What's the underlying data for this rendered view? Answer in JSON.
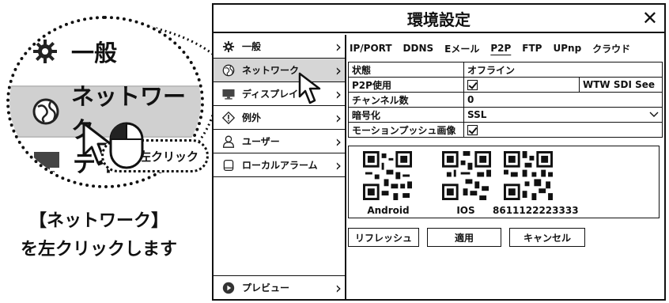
{
  "illustration": {
    "items": [
      {
        "label": "一般",
        "icon": "gear-icon"
      },
      {
        "label": "ネットワーク",
        "icon": "globe-icon"
      },
      {
        "label": "テイ",
        "icon": "monitor-icon"
      }
    ],
    "click_label": "左クリック",
    "instruction_line1": "【ネットワーク】",
    "instruction_line2": "を左クリックします"
  },
  "dialog": {
    "title": "環境設定",
    "close_glyph": "✕",
    "sidebar": [
      {
        "label": "一般",
        "icon": "gear-icon"
      },
      {
        "label": "ネットワーク",
        "icon": "globe-icon",
        "active": true
      },
      {
        "label": "ディスプレイ",
        "icon": "monitor-icon"
      },
      {
        "label": "例外",
        "icon": "warning-icon"
      },
      {
        "label": "ユーザー",
        "icon": "user-icon"
      },
      {
        "label": "ローカルアラーム",
        "icon": "storage-icon"
      }
    ],
    "sidebar_bottom": {
      "label": "プレビュー",
      "icon": "play-icon"
    },
    "chevron": "›",
    "tabs": [
      "IP/PORT",
      "DDNS",
      "Eメール",
      "P2P",
      "FTP",
      "UPnp",
      "クラウド"
    ],
    "active_tab": "P2P",
    "rows": {
      "status_label": "状態",
      "status_value": "オフライン",
      "p2p_label": "P2P使用",
      "app_name": "WTW SDI See",
      "channels_label": "チャンネル数",
      "channels_value": "0",
      "encryption_label": "暗号化",
      "encryption_value": "SSL",
      "motion_push_label": "モーションプッシュ画像"
    },
    "qr_codes": [
      {
        "label": "Android"
      },
      {
        "label": "IOS"
      },
      {
        "label": "8611122223333"
      }
    ],
    "buttons": {
      "refresh": "リフレッシュ",
      "apply": "適用",
      "cancel": "キャンセル"
    }
  }
}
